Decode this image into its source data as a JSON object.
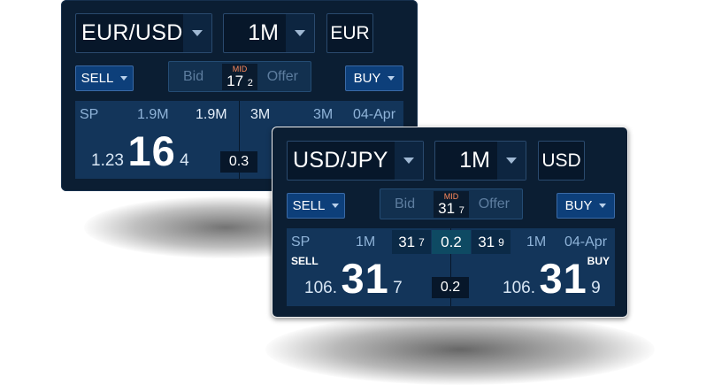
{
  "widgets": [
    {
      "pair": "EUR/USD",
      "amount": "1M",
      "ccy": "EUR",
      "sell_label": "SELL",
      "buy_label": "BUY",
      "bid_label": "Bid",
      "offer_label": "Offer",
      "mid_label": "MID",
      "mid_big": "17",
      "mid_pip": "2",
      "tenor": "SP",
      "left_amount_a": "1.9M",
      "left_amount_b": "1.9M",
      "right_amount_a": "3M",
      "right_amount_b": "3M",
      "date": "04-Apr",
      "sell_price_pre": "1.23",
      "sell_price_big": "16",
      "sell_price_pip": "4",
      "spread": "0.3"
    },
    {
      "pair": "USD/JPY",
      "amount": "1M",
      "ccy": "USD",
      "sell_label": "SELL",
      "buy_label": "BUY",
      "bid_label": "Bid",
      "offer_label": "Offer",
      "mid_label": "MID",
      "mid_big": "31",
      "mid_pip": "7",
      "tenor": "SP",
      "left_amount": "1M",
      "right_amount": "1M",
      "date": "04-Apr",
      "ladder_bid_big": "31",
      "ladder_bid_pip": "7",
      "ladder_spread": "0.2",
      "ladder_offer_big": "31",
      "ladder_offer_pip": "9",
      "sell_tag": "SELL",
      "buy_tag": "BUY",
      "sell_price_pre": "106.",
      "sell_price_big": "31",
      "sell_price_pip": "7",
      "buy_price_pre": "106.",
      "buy_price_big": "31",
      "buy_price_pip": "9",
      "spread": "0.2"
    }
  ],
  "colors": {
    "panel_bg": "#0b1e33",
    "price_bg": "#13355a",
    "button_blue": "#0d3f7a",
    "mid_accent": "#ff8a5c"
  }
}
